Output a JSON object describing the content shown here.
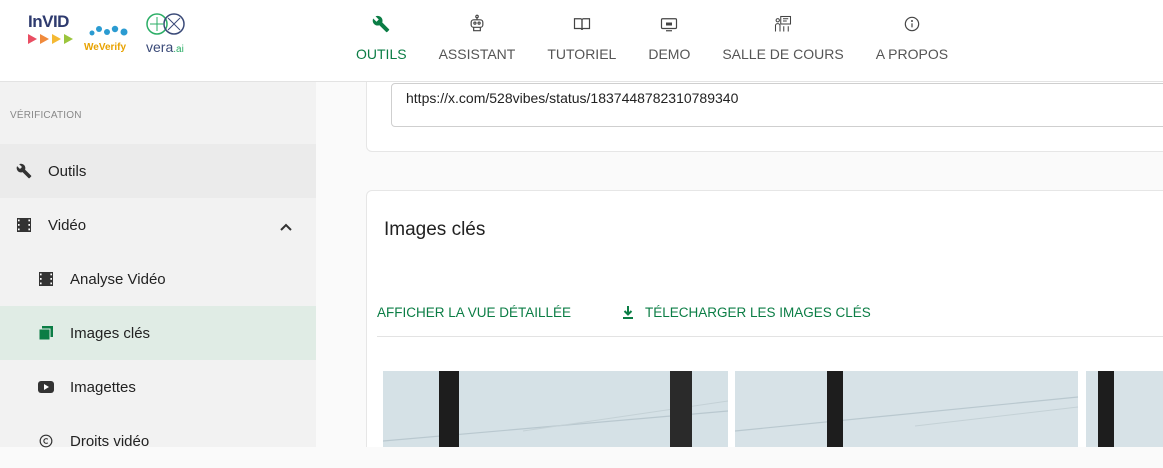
{
  "logos": {
    "invid": "InVID",
    "weverify": "WeVerify",
    "vera": "vera",
    "vera_ai": ".ai"
  },
  "nav": {
    "items": [
      {
        "label": "OUTILS",
        "icon": "wrench-icon",
        "active": true
      },
      {
        "label": "ASSISTANT",
        "icon": "robot-icon",
        "active": false
      },
      {
        "label": "TUTORIEL",
        "icon": "book-icon",
        "active": false
      },
      {
        "label": "DEMO",
        "icon": "demo-screen-icon",
        "active": false
      },
      {
        "label": "SALLE DE COURS",
        "icon": "classroom-icon",
        "active": false
      },
      {
        "label": "A PROPOS",
        "icon": "info-icon",
        "active": false
      }
    ]
  },
  "sidebar": {
    "section_title": "VÉRIFICATION",
    "items": [
      {
        "label": "Outils",
        "icon": "wrench-icon"
      },
      {
        "label": "Vidéo",
        "icon": "film-icon",
        "expanded": true
      },
      {
        "label": "Analyse Vidéo",
        "icon": "film-icon"
      },
      {
        "label": "Images clés",
        "icon": "keyframes-icon",
        "active": true
      },
      {
        "label": "Imagettes",
        "icon": "youtube-icon"
      },
      {
        "label": "Droits vidéo",
        "icon": "copyright-icon"
      }
    ]
  },
  "url_card": {
    "value": "https://x.com/528vibes/status/1837448782310789340"
  },
  "keyframes_card": {
    "title": "Images clés",
    "action_detailed": "AFFICHER LA VUE DÉTAILLÉE",
    "action_download": "TÉLECHARGER LES IMAGES CLÉS"
  },
  "colors": {
    "accent": "#0b7d45",
    "sidebar_bg": "#f2f2f2",
    "active_bg": "#e0ece5"
  }
}
